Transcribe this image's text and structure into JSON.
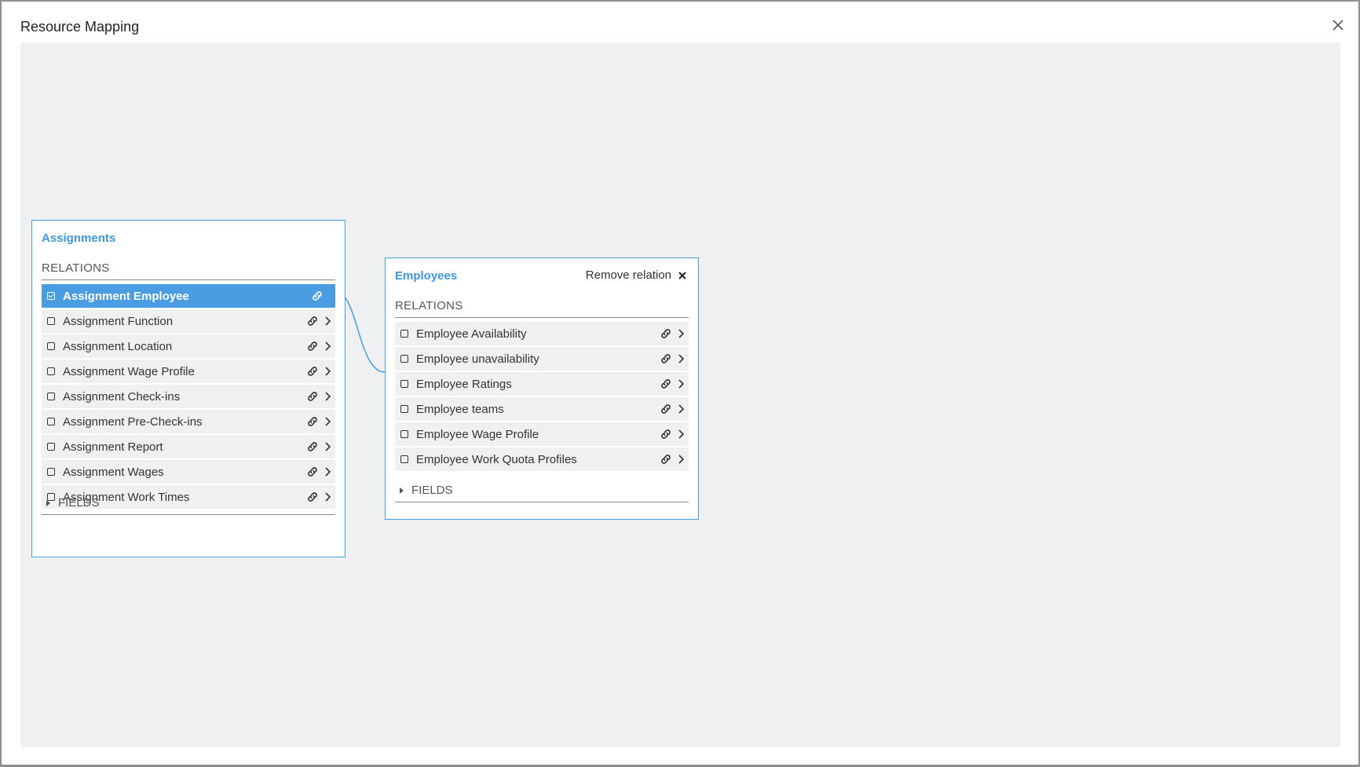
{
  "dialog": {
    "title": "Resource Mapping"
  },
  "source_entity": {
    "title": "Assignments",
    "relations_label": "RELATIONS",
    "fields_label": "FIELDS",
    "relations": [
      {
        "label": "Assignment Employee",
        "selected": true
      },
      {
        "label": "Assignment Function",
        "selected": false
      },
      {
        "label": "Assignment Location",
        "selected": false
      },
      {
        "label": "Assignment Wage Profile",
        "selected": false
      },
      {
        "label": "Assignment Check-ins",
        "selected": false
      },
      {
        "label": "Assignment Pre-Check-ins",
        "selected": false
      },
      {
        "label": "Assignment Report",
        "selected": false
      },
      {
        "label": "Assignment Wages",
        "selected": false
      },
      {
        "label": "Assignment Work Times",
        "selected": false
      }
    ]
  },
  "target_entity": {
    "title": "Employees",
    "remove_relation_label": "Remove relation",
    "relations_label": "RELATIONS",
    "fields_label": "FIELDS",
    "relations": [
      {
        "label": "Employee Availability"
      },
      {
        "label": "Employee unavailability"
      },
      {
        "label": "Employee Ratings"
      },
      {
        "label": "Employee teams"
      },
      {
        "label": "Employee Wage Profile"
      },
      {
        "label": "Employee Work Quota Profiles"
      }
    ]
  },
  "colors": {
    "accent": "#4a9de0",
    "canvas": "#eef0f2",
    "row": "#f0f0f0"
  }
}
